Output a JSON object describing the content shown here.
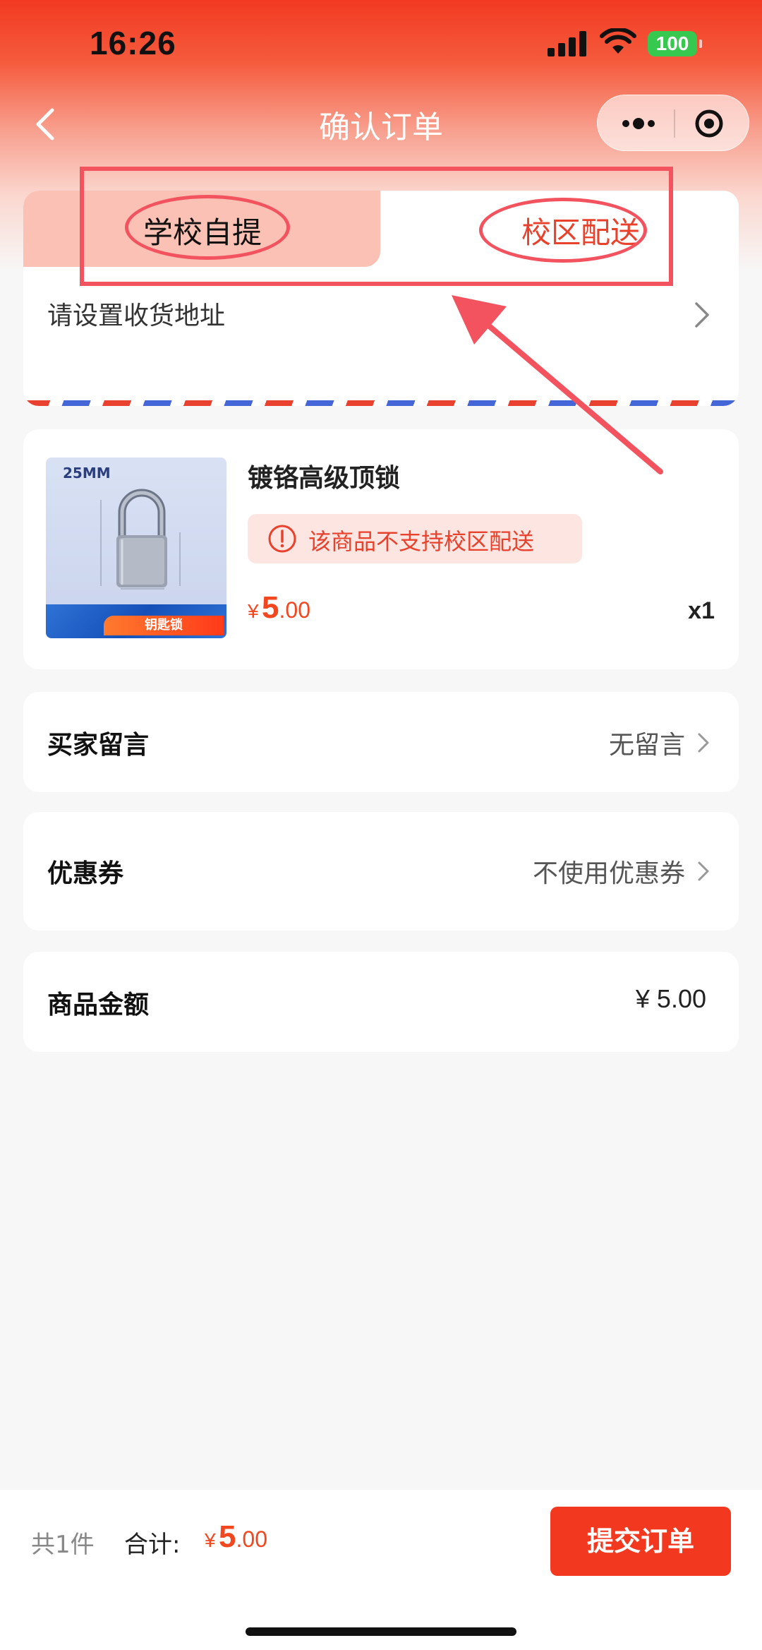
{
  "status_bar": {
    "time": "16:26",
    "battery": "100"
  },
  "nav": {
    "title": "确认订单"
  },
  "delivery": {
    "tabs": [
      {
        "label": "学校自提"
      },
      {
        "label": "校区配送"
      }
    ],
    "address_prompt": "请设置收货地址"
  },
  "product": {
    "image_size_label": "25MM",
    "image_tag": "钥匙锁",
    "name": "镀铬高级顶锁",
    "warning": "该商品不支持校区配送",
    "price": {
      "currency": "¥",
      "integer": "5",
      "decimal": ".00"
    },
    "quantity": "x1"
  },
  "buyer_message": {
    "label": "买家留言",
    "value": "无留言"
  },
  "coupon": {
    "label": "优惠券",
    "value": "不使用优惠券"
  },
  "amount": {
    "label": "商品金额",
    "value": "¥ 5.00"
  },
  "footer": {
    "count": "共1件",
    "total_label": "合计:",
    "total": {
      "currency": "¥",
      "integer": "5",
      "decimal": ".00"
    },
    "submit_label": "提交订单"
  },
  "colors": {
    "accent": "#f2381f",
    "annotation": "#f2535f",
    "warning_bg": "#fde6e2"
  }
}
